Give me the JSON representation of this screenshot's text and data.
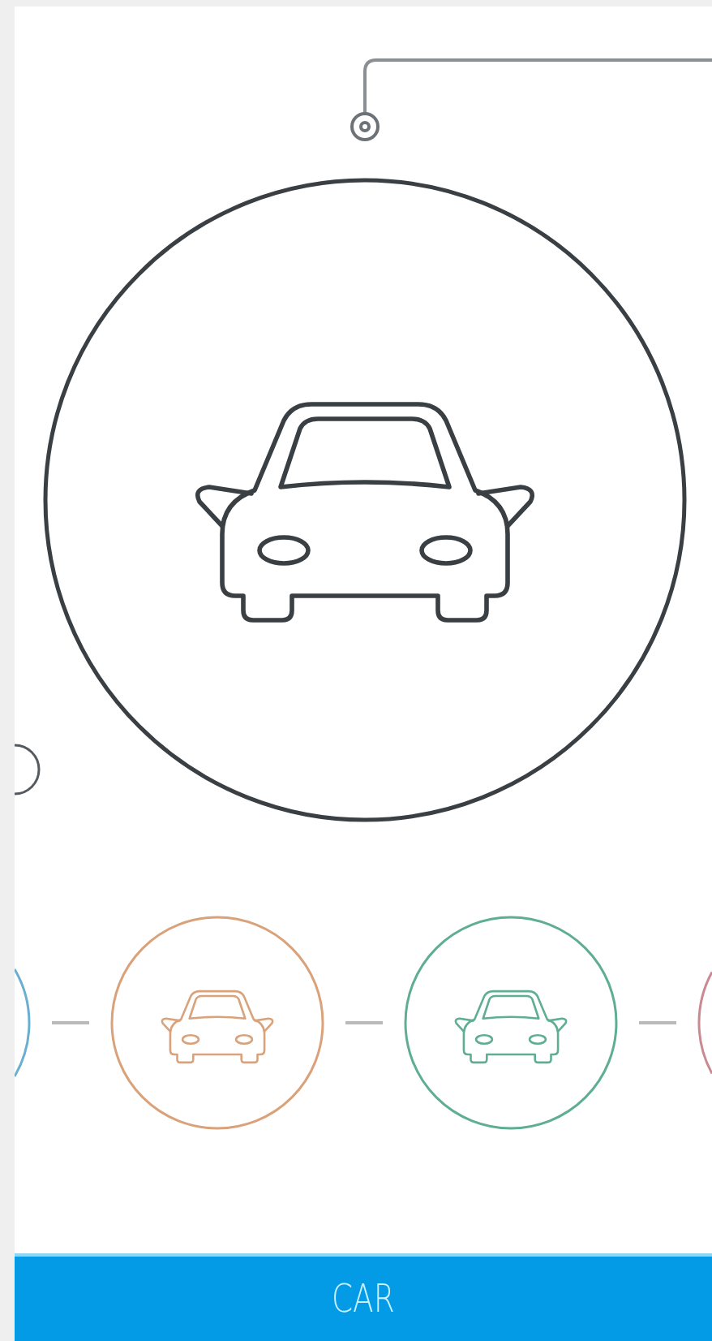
{
  "carousel": [
    {
      "color": "#6aaed0"
    },
    {
      "color": "#d9a27a"
    },
    {
      "color": "#5fae94"
    },
    {
      "color": "#c98a92"
    }
  ],
  "bottom_bar": {
    "label": "CAR"
  }
}
